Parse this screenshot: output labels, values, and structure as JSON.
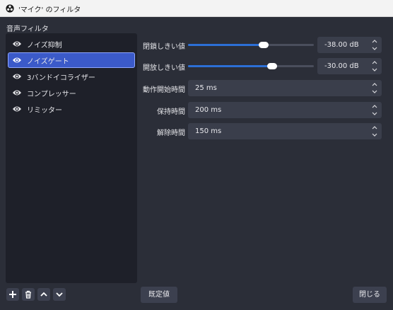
{
  "window": {
    "title": "'マイク' のフィルタ",
    "icon": "obs-logo-icon"
  },
  "section_label": "音声フィルタ",
  "filters": [
    {
      "label": "ノイズ抑制",
      "visible": true,
      "selected": false
    },
    {
      "label": "ノイズゲート",
      "visible": true,
      "selected": true
    },
    {
      "label": "3バンドイコライザー",
      "visible": true,
      "selected": false
    },
    {
      "label": "コンプレッサー",
      "visible": true,
      "selected": false
    },
    {
      "label": "リミッター",
      "visible": true,
      "selected": false
    }
  ],
  "list_buttons": [
    "plus-icon",
    "trash-icon",
    "chevron-up-icon",
    "chevron-down-icon"
  ],
  "properties": {
    "close_threshold": {
      "label": "閉鎖しきい値",
      "value_text": "-38.00 dB",
      "value": -38.0,
      "level": 0.6
    },
    "open_threshold": {
      "label": "開放しきい値",
      "value_text": "-30.00 dB",
      "value": -30.0,
      "level": 0.67
    },
    "attack_time": {
      "label": "動作開始時間",
      "value_text": "25 ms"
    },
    "hold_time": {
      "label": "保持時間",
      "value_text": "200 ms"
    },
    "release_time": {
      "label": "解除時間",
      "value_text": "150 ms"
    }
  },
  "buttons": {
    "defaults": "既定値",
    "close": "閉じる"
  },
  "colors": {
    "background": "#2b2e38",
    "list_background": "#1e2029",
    "selection": "#3b5ac9",
    "accent": "#2c6fd6"
  }
}
